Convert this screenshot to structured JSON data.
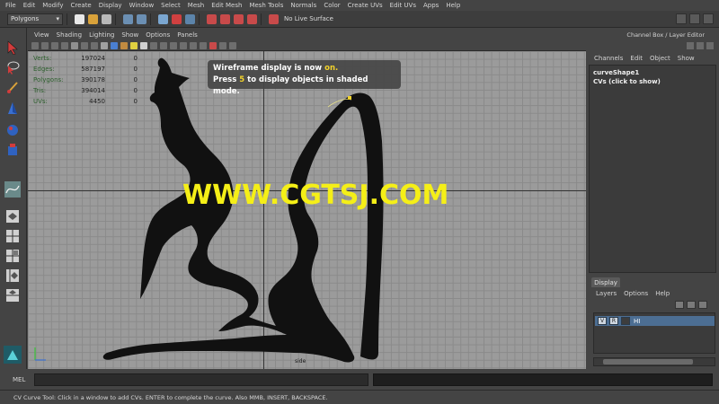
{
  "menu": [
    "File",
    "Edit",
    "Modify",
    "Create",
    "Display",
    "Window",
    "Select",
    "Mesh",
    "Edit Mesh",
    "Mesh Tools",
    "Normals",
    "Color",
    "Create UVs",
    "Edit UVs",
    "Apps",
    "Help"
  ],
  "status_line": {
    "mode": "Polygons",
    "live_surface": "No Live Surface"
  },
  "viewport": {
    "menu": [
      "View",
      "Shading",
      "Lighting",
      "Show",
      "Options",
      "Panels"
    ],
    "hud": [
      {
        "label": "Verts:",
        "v1": "197024",
        "v2": "0"
      },
      {
        "label": "Edges:",
        "v1": "587197",
        "v2": "0"
      },
      {
        "label": "Polygons:",
        "v1": "390178",
        "v2": "0"
      },
      {
        "label": "Tris:",
        "v1": "394014",
        "v2": "0"
      },
      {
        "label": "UVs:",
        "v1": "4450",
        "v2": "0"
      }
    ],
    "message": {
      "line1_pre": "Wireframe display is now ",
      "line1_hl": "on.",
      "line2_pre": "Press ",
      "line2_hl": "5",
      "line2_post": " to display objects in shaded mode."
    },
    "watermark": "WWW.CGTSJ.COM",
    "camera_label": "side"
  },
  "channel_box": {
    "title": "Channel Box / Layer Editor",
    "menu": [
      "Channels",
      "Edit",
      "Object",
      "Show"
    ],
    "object_name": "curveShape1",
    "cvs_label": "CVs (click to show)"
  },
  "layer_editor": {
    "tab": "Display",
    "menu": [
      "Layers",
      "Options",
      "Help"
    ],
    "layer": {
      "v": "V",
      "r": "R",
      "name": "HI"
    }
  },
  "command_line": {
    "label": "MEL"
  },
  "help_line": "CV Curve Tool: Click in a window to add CVs. ENTER to complete the curve. Also MMB, INSERT, BACKSPACE."
}
